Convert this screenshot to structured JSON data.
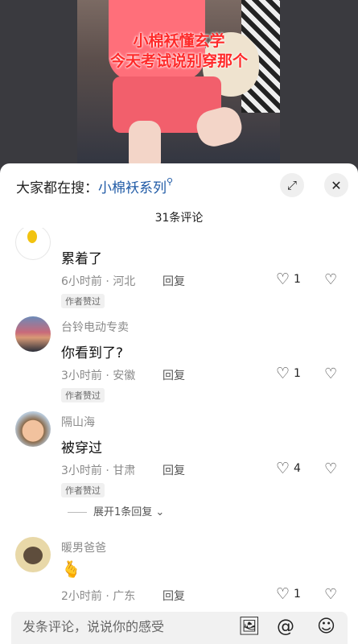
{
  "video": {
    "caption_line1": "小棉袄懂玄学",
    "caption_line2": "今天考试说别穿那个"
  },
  "header": {
    "search_prefix": "大家都在搜：",
    "search_keyword": "小棉袄系列",
    "comment_count": "31条评论"
  },
  "comments": [
    {
      "name": "",
      "text": "累着了",
      "meta": "6小时前 · 河北",
      "reply": "回复",
      "badge": "作者赞过",
      "likes": "1"
    },
    {
      "name": "台铃电动专卖",
      "text": "你看到了?",
      "meta": "3小时前 · 安徽",
      "reply": "回复",
      "badge": "作者赞过",
      "likes": "1"
    },
    {
      "name": "隔山海",
      "text": "被穿过",
      "meta": "3小时前 · 甘肃",
      "reply": "回复",
      "badge": "作者赞过",
      "likes": "4",
      "expand_replies": "展开1条回复"
    },
    {
      "name": "暖男爸爸",
      "text": "",
      "meta": "2小时前 · 广东",
      "reply": "回复",
      "likes": "1"
    }
  ],
  "input": {
    "placeholder": "发条评论，说说你的感受"
  },
  "icons": {
    "expand": "expand-icon",
    "close": "close-icon",
    "image": "image-icon",
    "mention": "at-icon",
    "emoji": "emoji-icon"
  }
}
